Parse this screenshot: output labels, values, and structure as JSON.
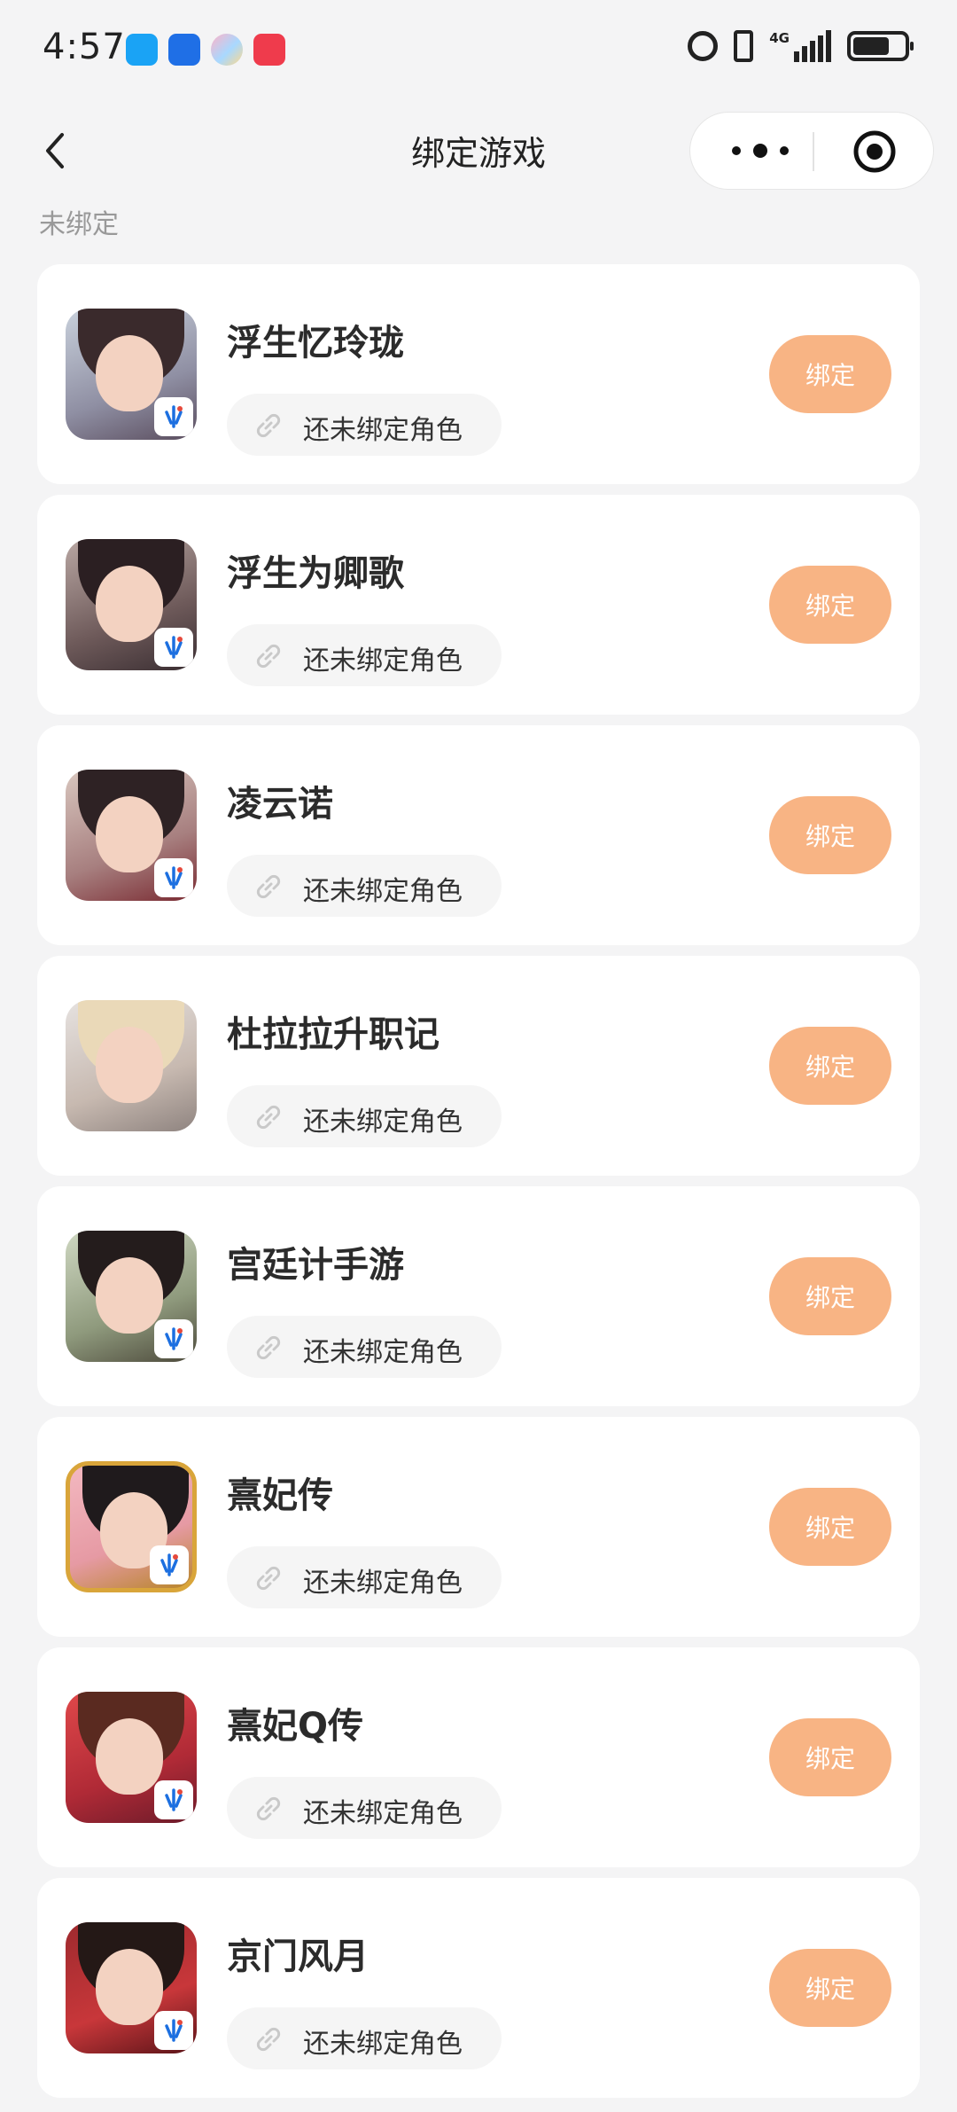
{
  "status_bar": {
    "time": "4:57",
    "network": "4G"
  },
  "nav": {
    "title": "绑定游戏"
  },
  "section": {
    "label": "未绑定"
  },
  "games": [
    {
      "name": "浮生忆玲珑",
      "status": "还未绑定角色",
      "action": "绑定"
    },
    {
      "name": "浮生为卿歌",
      "status": "还未绑定角色",
      "action": "绑定"
    },
    {
      "name": "凌云诺",
      "status": "还未绑定角色",
      "action": "绑定"
    },
    {
      "name": "杜拉拉升职记",
      "status": "还未绑定角色",
      "action": "绑定"
    },
    {
      "name": "宫廷计手游",
      "status": "还未绑定角色",
      "action": "绑定"
    },
    {
      "name": "熹妃传",
      "status": "还未绑定角色",
      "action": "绑定"
    },
    {
      "name": "熹妃Q传",
      "status": "还未绑定角色",
      "action": "绑定"
    },
    {
      "name": "京门风月",
      "status": "还未绑定角色",
      "action": "绑定"
    }
  ],
  "colors": {
    "accent": "#f8b484",
    "background": "#f4f4f5",
    "card": "#ffffff"
  }
}
